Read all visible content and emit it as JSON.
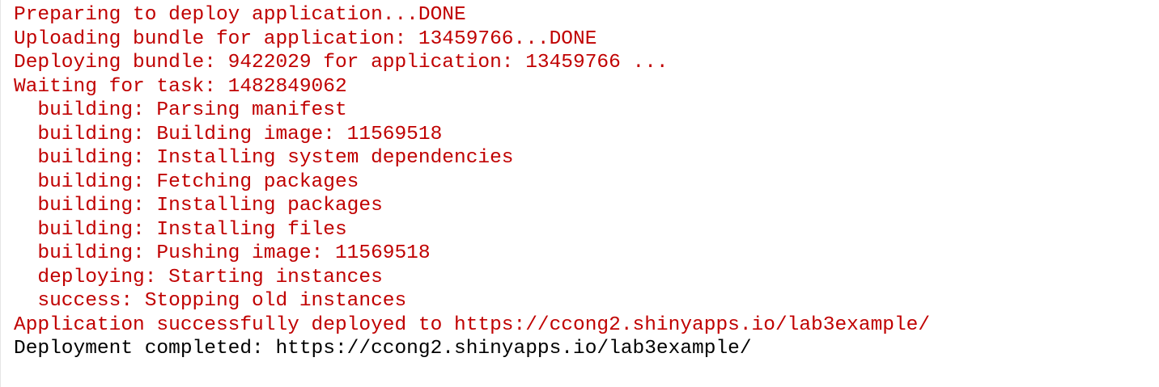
{
  "console": {
    "lines": [
      {
        "text": "Preparing to deploy application...DONE",
        "style": "message"
      },
      {
        "text": "Uploading bundle for application: 13459766...DONE",
        "style": "message"
      },
      {
        "text": "Deploying bundle: 9422029 for application: 13459766 ...",
        "style": "message"
      },
      {
        "text": "Waiting for task: 1482849062",
        "style": "message"
      },
      {
        "text": "  building: Parsing manifest",
        "style": "message"
      },
      {
        "text": "  building: Building image: 11569518",
        "style": "message"
      },
      {
        "text": "  building: Installing system dependencies",
        "style": "message"
      },
      {
        "text": "  building: Fetching packages",
        "style": "message"
      },
      {
        "text": "  building: Installing packages",
        "style": "message"
      },
      {
        "text": "  building: Installing files",
        "style": "message"
      },
      {
        "text": "  building: Pushing image: 11569518",
        "style": "message"
      },
      {
        "text": "  deploying: Starting instances",
        "style": "message"
      },
      {
        "text": "  success: Stopping old instances",
        "style": "message"
      },
      {
        "text": "Application successfully deployed to https://ccong2.shinyapps.io/lab3example/",
        "style": "message"
      },
      {
        "text": "Deployment completed: https://ccong2.shinyapps.io/lab3example/",
        "style": "output"
      }
    ]
  },
  "colors": {
    "message": "#c00000",
    "output": "#000000",
    "background": "#ffffff"
  }
}
